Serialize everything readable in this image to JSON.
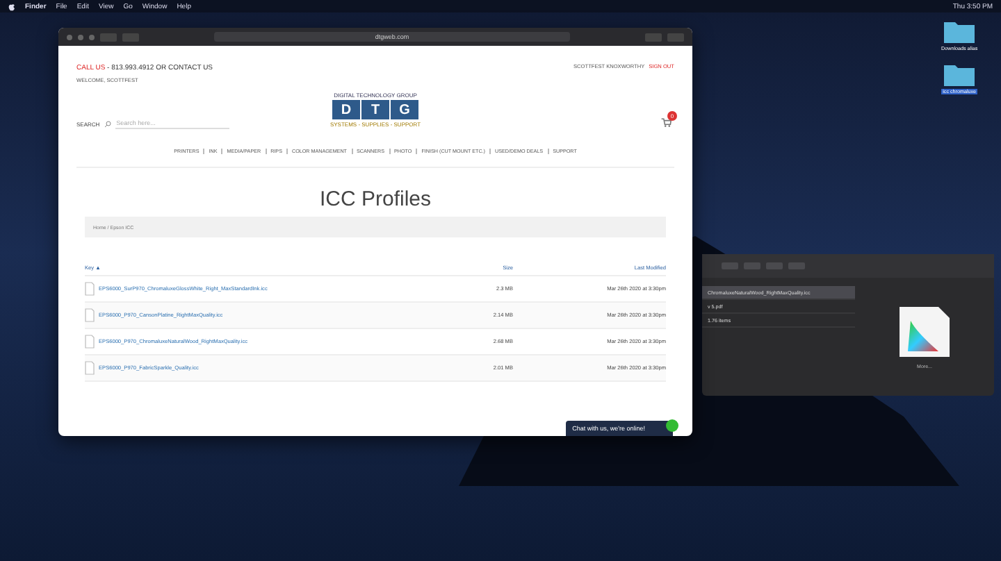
{
  "menubar": {
    "items": [
      "Finder",
      "File",
      "Edit",
      "View",
      "Go",
      "Window",
      "Help"
    ],
    "clock": "Thu 3:50 PM"
  },
  "browser": {
    "url": "dtgweb.com",
    "header": {
      "call_label": "CALL US",
      "call_text": " - 813.993.4912 OR CONTACT US",
      "welcome": "WELCOME, SCOTTFEST",
      "account": "SCOTTFEST KNOXWORTHY",
      "sign_out": "SIGN OUT"
    },
    "logo": {
      "top": "DIGITAL TECHNOLOGY GROUP",
      "letters": [
        "D",
        "T",
        "G"
      ],
      "bottom": "SYSTEMS - SUPPLIES - SUPPORT"
    },
    "search": {
      "label": "SEARCH",
      "placeholder": "Search here..."
    },
    "cart_count": "0",
    "nav": [
      "PRINTERS",
      "INK",
      "MEDIA/PAPER",
      "RIPS",
      "COLOR MANAGEMENT",
      "SCANNERS",
      "PHOTO",
      "FINISH (CUT MOUNT ETC.)",
      "USED/DEMO DEALS",
      "SUPPORT"
    ],
    "page_title": "ICC Profiles",
    "breadcrumb": "Home / Epson ICC",
    "table": {
      "columns": [
        "Key ▲",
        "Size",
        "Last Modified"
      ],
      "rows": [
        {
          "name": "EPS6000_SurP970_ChromaluxeGlossWhite_Right_MaxStandardInk.icc",
          "size": "2.3 MB",
          "modified": "Mar 26th 2020 at 3:30pm"
        },
        {
          "name": "EPS6000_P970_CansonPlatine_RightMaxQuality.icc",
          "size": "2.14 MB",
          "modified": "Mar 26th 2020 at 3:30pm"
        },
        {
          "name": "EPS6000_P970_ChromaluxeNaturalWood_RightMaxQuality.icc",
          "size": "2.68 MB",
          "modified": "Mar 26th 2020 at 3:30pm"
        },
        {
          "name": "EPS6000_P970_FabricSparkle_Quality.icc",
          "size": "2.01 MB",
          "modified": "Mar 26th 2020 at 3:30pm"
        }
      ]
    },
    "chat": "Chat with us, we're online!"
  },
  "finder": {
    "rows": [
      {
        "name": "ChromaluxeNaturalWood_RightMaxQuality.icc",
        "selected": true
      },
      {
        "name": "v 5.pdf",
        "selected": false
      },
      {
        "name": "1.76 items",
        "selected": false
      }
    ],
    "preview_caption": "More..."
  },
  "desktop_icons": [
    {
      "label": "Downloads alias",
      "selected": false
    },
    {
      "label": "icc chromaluxe",
      "selected": true
    }
  ]
}
